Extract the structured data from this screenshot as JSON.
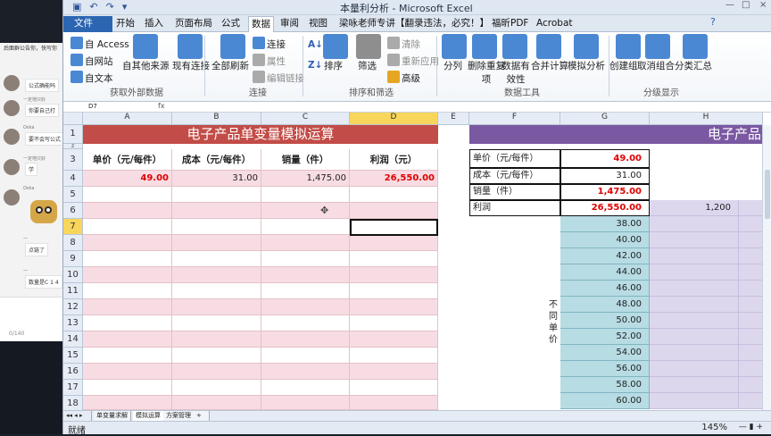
{
  "chat": {
    "notice": "后面群公告你，快写你",
    "messages": [
      {
        "name": "",
        "text": "公式确能吗"
      },
      {
        "name": "一定地只好",
        "text": "你要自己打"
      },
      {
        "name": "Oska",
        "text": "要不会写公式"
      },
      {
        "name": "一定地只好",
        "text": "学"
      },
      {
        "name": "Oska",
        "text": ""
      },
      {
        "name": "一",
        "text": "点链了"
      },
      {
        "name": "一",
        "text": "数量是C 1 4"
      }
    ],
    "counter": "0/140"
  },
  "excel": {
    "window_title": "本量利分析 - Microsoft Excel",
    "tabs": [
      "文件",
      "开始",
      "插入",
      "页面布局",
      "公式",
      "数据",
      "审阅",
      "视图",
      "梁咏老师专讲【翻录违法，必究！】",
      "福昕PDF",
      "Acrobat"
    ],
    "active_tab": "数据",
    "ribbon": {
      "groups": [
        "获取外部数据",
        "连接",
        "排序和筛选",
        "数据工具",
        "分级显示"
      ],
      "get_data": [
        "自 Access",
        "自网站",
        "自文本",
        "自其他来源",
        "现有连接"
      ],
      "connections": [
        "全部刷新",
        "连接",
        "属性",
        "编辑链接"
      ],
      "sort_filter": [
        "排序",
        "筛选",
        "清除",
        "重新应用",
        "高级"
      ],
      "tools": [
        "分列",
        "删除重复项",
        "数据有效性",
        "合并计算",
        "模拟分析"
      ],
      "outline": [
        "创建组",
        "取消组合",
        "分类汇总"
      ]
    },
    "name_box": "D7",
    "fx": "fx",
    "column_headers": [
      "A",
      "B",
      "C",
      "D",
      "E",
      "F",
      "G",
      "H"
    ],
    "row_numbers": [
      "1",
      "2",
      "3",
      "4",
      "5",
      "6",
      "7",
      "8",
      "9",
      "10",
      "11",
      "12",
      "13",
      "14",
      "15",
      "16",
      "17",
      "18"
    ],
    "left_title": "电子产品单变量模拟运算",
    "right_title": "电子产品",
    "headers": [
      "单价（元/每件）",
      "成本（元/每件）",
      "销量（件）",
      "利润（元）"
    ],
    "row4": [
      "49.00",
      "31.00",
      "1,475.00",
      "26,550.00"
    ],
    "right_table": [
      {
        "label": "单价（元/每件）",
        "value": "49.00"
      },
      {
        "label": "成本（元/每件）",
        "value": "31.00"
      },
      {
        "label": "销量（件）",
        "value": "1,475.00"
      },
      {
        "label": "利润",
        "value": "26,550.00"
      }
    ],
    "h6_value": "1,200",
    "price_series": [
      "38.00",
      "40.00",
      "42.00",
      "44.00",
      "46.00",
      "48.00",
      "50.00",
      "52.00",
      "54.00",
      "56.00",
      "58.00",
      "60.00"
    ],
    "vertical_label": "不同单价",
    "sheets": [
      "单变量求解",
      "模拟运算",
      "方案管理"
    ],
    "status": "就绪",
    "zoom": "145%"
  }
}
